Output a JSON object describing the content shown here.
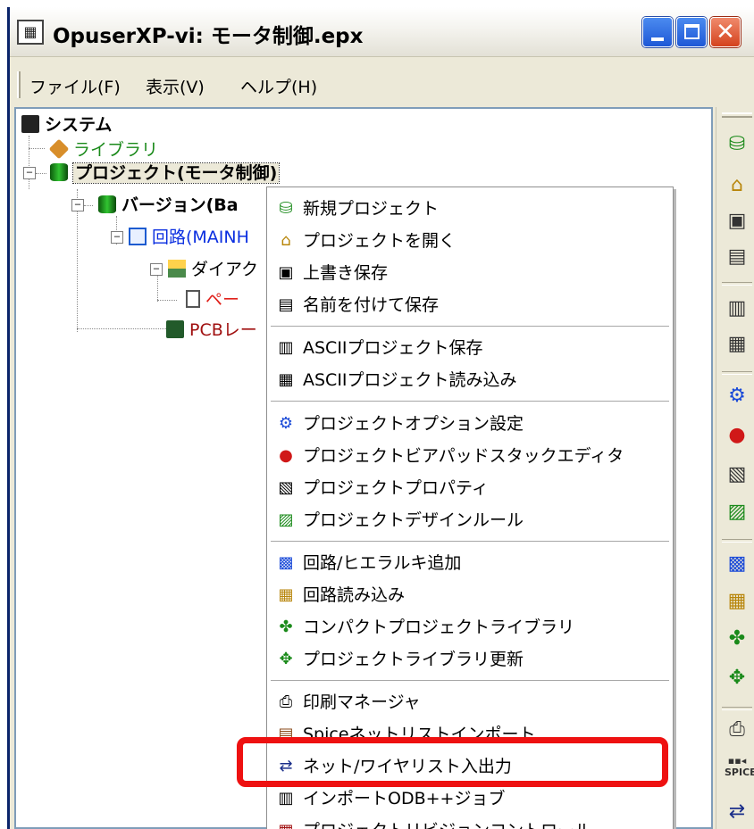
{
  "window": {
    "title": "OpuserXP-vi: モータ制御.epx"
  },
  "menubar": {
    "items": [
      "ファイル(F)",
      "表示(V)",
      "ヘルプ(H)"
    ]
  },
  "tree": {
    "system": "システム",
    "library": "ライブラリ",
    "project": "プロジェクト(モータ制御)",
    "version": "バージョン(Ba",
    "circuit": "回路(MAINH",
    "diagram": "ダイアク",
    "page": "ペー",
    "pcb": "PCBレー"
  },
  "context_menu": {
    "items": [
      {
        "label": "新規プロジェクト",
        "icon": "new-project-icon"
      },
      {
        "label": "プロジェクトを開く",
        "icon": "open-folder-icon"
      },
      {
        "label": "上書き保存",
        "icon": "save-icon"
      },
      {
        "label": "名前を付けて保存",
        "icon": "save-as-icon"
      },
      {
        "label": "ASCIIプロジェクト保存",
        "icon": "ascii-save-icon"
      },
      {
        "label": "ASCIIプロジェクト読み込み",
        "icon": "ascii-load-icon"
      },
      {
        "label": "プロジェクトオプション設定",
        "icon": "gears-icon"
      },
      {
        "label": "プロジェクトビアパッドスタックエディタ",
        "icon": "via-pad-icon"
      },
      {
        "label": "プロジェクトプロパティ",
        "icon": "properties-icon"
      },
      {
        "label": "プロジェクトデザインルール",
        "icon": "design-rule-icon"
      },
      {
        "label": "回路/ヒエラルキ追加",
        "icon": "add-circuit-icon"
      },
      {
        "label": "回路読み込み",
        "icon": "load-circuit-icon"
      },
      {
        "label": "コンパクトプロジェクトライブラリ",
        "icon": "compact-library-icon"
      },
      {
        "label": "プロジェクトライブラリ更新",
        "icon": "update-library-icon"
      },
      {
        "label": "印刷マネージャ",
        "icon": "printer-icon"
      },
      {
        "label": "Spiceネットリストインポート",
        "icon": "spice-import-icon"
      },
      {
        "label": "ネット/ワイヤリスト入出力",
        "icon": "net-io-icon"
      },
      {
        "label": "インポートODB++ジョブ",
        "icon": "odb-import-icon"
      },
      {
        "label": "プロジェクトリビジョンコントロール",
        "icon": "revision-control-icon"
      }
    ]
  },
  "colors": {
    "library_text": "#1a8a1a",
    "circuit_text": "#0a2ee0",
    "page_text": "#e0201a",
    "pcb_text": "#a01010",
    "highlight": "#ee1111"
  }
}
